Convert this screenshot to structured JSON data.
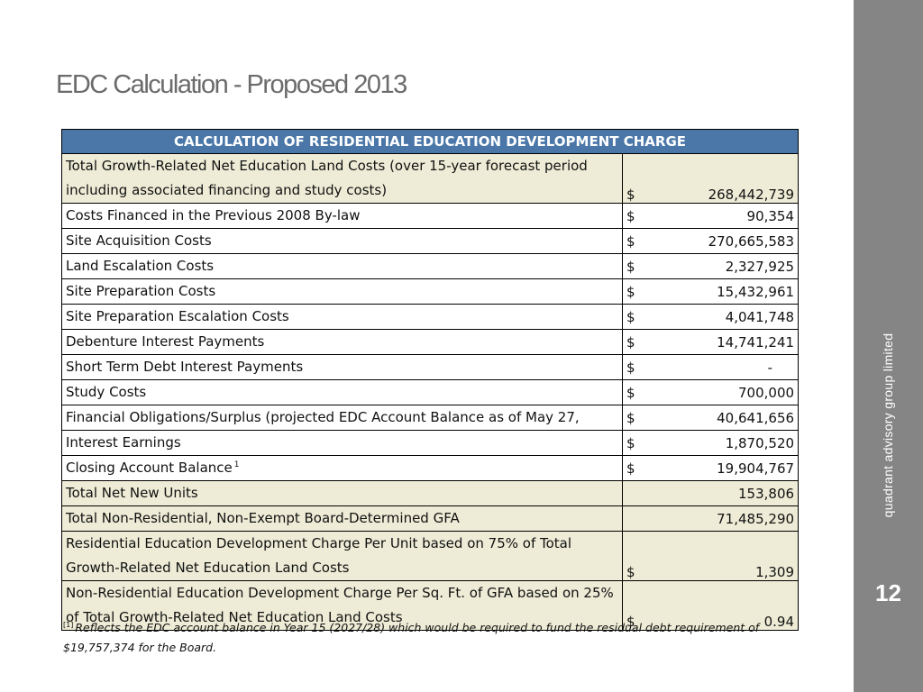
{
  "slide": {
    "title": "EDC Calculation - Proposed 2013",
    "brand": "quadrant advisory group limited",
    "page_number": "12"
  },
  "table": {
    "header": "CALCULATION OF RESIDENTIAL EDUCATION DEVELOPMENT CHARGE",
    "rows": [
      {
        "label": "Total Growth-Related Net Education Land Costs (over 15-year forecast period including associated financing and study costs)",
        "currency": "$",
        "value": "268,442,739"
      },
      {
        "label": "Costs Financed in the Previous 2008 By-law",
        "currency": "$",
        "value": "90,354"
      },
      {
        "label": "Site Acquisition Costs",
        "currency": "$",
        "value": "270,665,583"
      },
      {
        "label": "Land Escalation Costs",
        "currency": "$",
        "value": "2,327,925"
      },
      {
        "label": "Site Preparation Costs",
        "currency": "$",
        "value": "15,432,961"
      },
      {
        "label": "Site Preparation Escalation Costs",
        "currency": "$",
        "value": "4,041,748"
      },
      {
        "label": "Debenture Interest Payments",
        "currency": "$",
        "value": "14,741,241"
      },
      {
        "label": "Short Term Debt Interest Payments",
        "currency": "$",
        "value": "-"
      },
      {
        "label": "Study Costs",
        "currency": "$",
        "value": "700,000"
      },
      {
        "label": "Financial Obligations/Surplus (projected EDC Account Balance as of May 27,",
        "currency": "$",
        "value": "40,641,656"
      },
      {
        "label": "Interest Earnings",
        "currency": "$",
        "value": "1,870,520"
      },
      {
        "label": "Closing Account Balance",
        "note": "1",
        "currency": "$",
        "value": "19,904,767"
      },
      {
        "label": "Total Net New Units",
        "currency": "",
        "value": "153,806"
      },
      {
        "label": "Total Non-Residential, Non-Exempt Board-Determined GFA",
        "currency": "",
        "value": "71,485,290"
      },
      {
        "label": "Residential Education Development Charge Per Unit based on 75% of Total Growth-Related Net Education Land Costs",
        "currency": "$",
        "value": "1,309"
      },
      {
        "label": "Non-Residential Education Development Charge Per Sq. Ft. of GFA based on 25% of Total Growth-Related Net Education Land Costs",
        "currency": "$",
        "value": "0.94"
      }
    ]
  },
  "footnote": {
    "marker": "[1]",
    "text": "Reflects the EDC account balance in Year 15 (2027/28) which would be required to fund the residual debt requirement of $19,757,374 for the Board."
  }
}
